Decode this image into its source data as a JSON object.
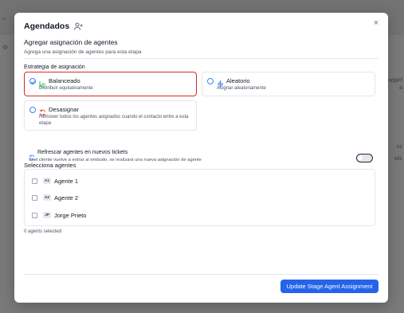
{
  "background": {
    "side_texts": [
      "ondaFf",
      "a",
      "oc",
      "olic"
    ]
  },
  "modal": {
    "title": "Agendados",
    "close_label": "×",
    "subtitle": "Agregar asignación de agentes",
    "description": "Agrega una asignación de agentes para esta etapa",
    "strategy_label": "Estrategia de asignación",
    "options": [
      {
        "title": "Balanceado",
        "subtitle": "Distribuir equitativamente",
        "selected": true,
        "icon": "bar-chart-icon",
        "icon_color": "#22c55e"
      },
      {
        "title": "Aleatorio",
        "subtitle": "Asignar aleatoriamente",
        "selected": false,
        "icon": "lightning-icon",
        "icon_color": "#3b82f6"
      },
      {
        "title": "Desasignar",
        "subtitle": "Remover todos los agentes asignados cuando el contacto entre a esta etapa",
        "selected": false,
        "icon": "refresh-icon",
        "icon_color": "#ef4444"
      }
    ],
    "refresh": {
      "title": "Refrescar agentes en nuevos tickets",
      "description": "Si el cliente vuelve a entrar al embudo, se realizará una nueva asignación de agente",
      "enabled": false
    },
    "agents_label": "Selecciona agentes",
    "agents": [
      {
        "initials": "A1",
        "name": "Agente 1",
        "checked": false
      },
      {
        "initials": "A2",
        "name": "Agente 2",
        "checked": false
      },
      {
        "initials": "JP",
        "name": "Jorge Prieto",
        "checked": false
      }
    ],
    "selected_count": "0 agents selected",
    "submit_label": "Update Stage Agent Assignment"
  },
  "colors": {
    "accent": "#2563eb",
    "selected_border": "#dc2626"
  }
}
